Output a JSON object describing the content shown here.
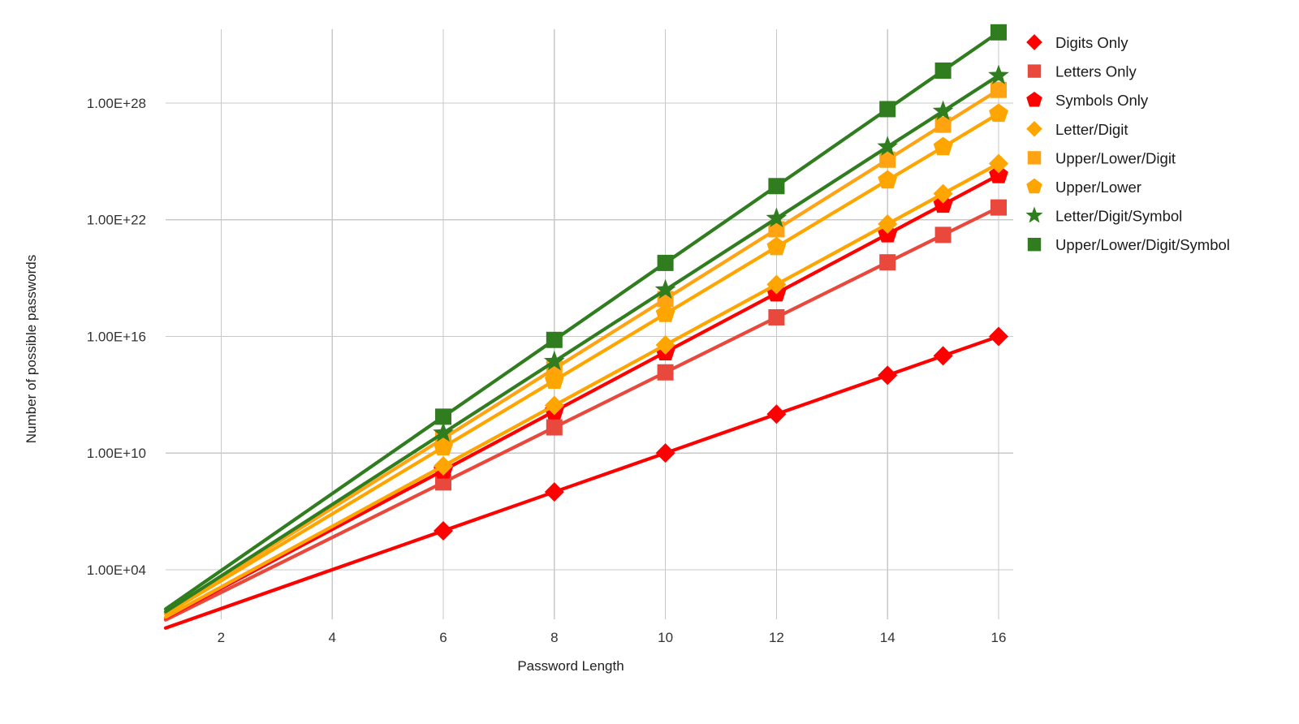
{
  "chart_data": {
    "type": "line",
    "title": "",
    "xlabel": "Password Length",
    "ylabel": "Number of possible passwords",
    "x": [
      1,
      6,
      8,
      10,
      12,
      14,
      15,
      16
    ],
    "x_tick_labels": [
      "2",
      "4",
      "6",
      "8",
      "10",
      "12",
      "14",
      "16"
    ],
    "x_tick_values": [
      2,
      4,
      6,
      8,
      10,
      12,
      14,
      16
    ],
    "xlim": [
      1,
      16
    ],
    "y_scale": "log",
    "y_tick_labels": [
      "1.00E+28",
      "1.00E+22",
      "1.00E+16",
      "1.00E+10",
      "1.00E+04"
    ],
    "y_tick_exponents": [
      28,
      22,
      16,
      10,
      4
    ],
    "ylim_exponents": [
      2.2,
      31.8
    ],
    "grid": true,
    "legend_position": "right",
    "series": [
      {
        "name": "Digits Only",
        "marker": "diamond",
        "color": "#FF0000",
        "base": 10,
        "exponents": [
          1,
          6,
          8,
          10,
          12,
          14,
          15,
          16
        ],
        "values": [
          10,
          1000000,
          100000000,
          10000000000,
          1000000000000,
          100000000000000,
          1000000000000000,
          10000000000000000
        ]
      },
      {
        "name": "Letters Only",
        "marker": "square",
        "color": "#E8493C",
        "base": 26,
        "exponents": [
          1.415,
          8.49,
          11.32,
          14.15,
          16.98,
          19.81,
          21.22,
          22.63
        ],
        "values": [
          26,
          309000000.0,
          209000000000.0,
          141000000000000.0,
          9.54e+16,
          6.45e+19,
          1.68e+21,
          4.36e+22
        ]
      },
      {
        "name": "Symbols Only",
        "marker": "pentagon",
        "color": "#FF0000",
        "base": 33,
        "exponents": [
          1.519,
          9.11,
          12.15,
          15.19,
          18.22,
          21.26,
          22.78,
          24.3
        ],
        "values": [
          33,
          1290000000.0,
          1410000000000.0,
          1530000000000000.0,
          1.67e+18,
          1.82e+21,
          6e+22,
          1.98e+24
        ]
      },
      {
        "name": "Letter/Digit",
        "marker": "diamond",
        "color": "#FFA500",
        "base": 36,
        "exponents": [
          1.556,
          9.34,
          12.45,
          15.56,
          18.67,
          21.78,
          23.34,
          24.89
        ],
        "values": [
          36,
          2180000000.0,
          2820000000000.0,
          3660000000000000.0,
          4.74e+18,
          6.14e+21,
          2.21e+23,
          7.96e+24
        ]
      },
      {
        "name": "Upper/Lower/Digit",
        "marker": "square",
        "color": "#FFA313",
        "base": 62,
        "exponents": [
          1.792,
          10.75,
          14.34,
          17.92,
          21.51,
          25.09,
          26.89,
          28.68
        ],
        "values": [
          62,
          56800000000.0,
          218000000000000.0,
          8.39e+17,
          3.23e+21,
          1.24e+25,
          7.7e+26,
          4.77e+28
        ]
      },
      {
        "name": "Upper/Lower",
        "marker": "pentagon",
        "color": "#FFA500",
        "base": 52,
        "exponents": [
          1.716,
          10.3,
          13.73,
          17.16,
          20.6,
          24.03,
          25.74,
          27.46
        ],
        "values": [
          52,
          19800000000.0,
          53500000000000.0,
          1.45e+17,
          3.91e+20,
          1.06e+24,
          5.49e+25,
          2.86e+27
        ]
      },
      {
        "name": "Letter/Digit/Symbol",
        "marker": "star",
        "color": "#2F7D1F",
        "base": 69,
        "exponents": [
          1.839,
          11.03,
          14.71,
          18.39,
          22.07,
          25.75,
          27.58,
          29.42
        ],
        "values": [
          69,
          108000000000.0,
          513000000000000.0,
          2.44e+18,
          1.16e+22,
          5.54e+25,
          3.82e+27,
          2.64e+29
        ]
      },
      {
        "name": "Upper/Lower/Digit/Symbol",
        "marker": "square",
        "color": "#2F7D1F",
        "base": 95,
        "exponents": [
          1.978,
          11.87,
          15.82,
          19.78,
          23.73,
          27.69,
          29.67,
          31.64
        ],
        "values": [
          95,
          735000000000.0,
          6630000000000000.0,
          5.99e+19,
          5.4e+23,
          4.88e+27,
          4.63e+29,
          4.4e+31
        ]
      }
    ]
  },
  "legend": {
    "items": [
      {
        "label": "Digits Only",
        "marker": "diamond",
        "color": "#FF0000"
      },
      {
        "label": "Letters Only",
        "marker": "square",
        "color": "#E8493C"
      },
      {
        "label": "Symbols Only",
        "marker": "pentagon",
        "color": "#FF0000"
      },
      {
        "label": "Letter/Digit",
        "marker": "diamond",
        "color": "#FFA500"
      },
      {
        "label": "Upper/Lower/Digit",
        "marker": "square",
        "color": "#FFA313"
      },
      {
        "label": "Upper/Lower",
        "marker": "pentagon",
        "color": "#FFA500"
      },
      {
        "label": "Letter/Digit/Symbol",
        "marker": "star",
        "color": "#2F7D1F"
      },
      {
        "label": "Upper/Lower/Digit/Symbol",
        "marker": "square",
        "color": "#2F7D1F"
      }
    ]
  }
}
